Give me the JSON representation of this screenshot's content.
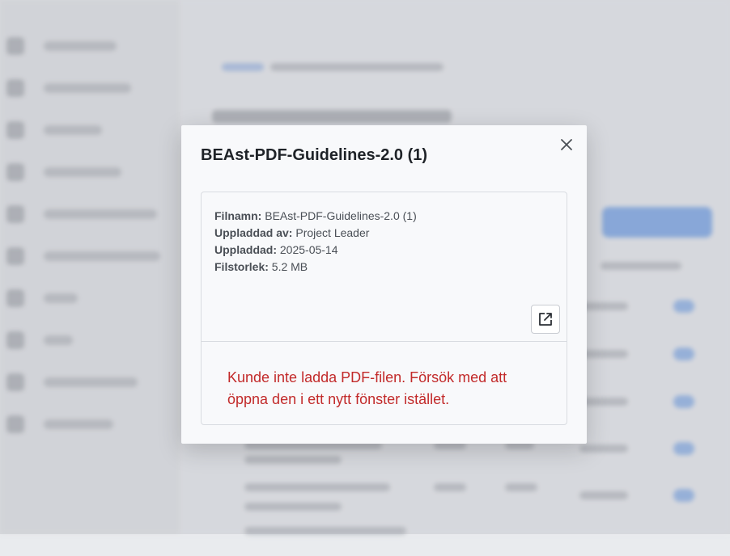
{
  "modal": {
    "title": "BEAst-PDF-Guidelines-2.0 (1)",
    "close_icon": "close-icon",
    "info": {
      "filename_label": "Filnamn:",
      "filename_value": "BEAst-PDF-Guidelines-2.0 (1)",
      "uploaded_by_label": "Uppladdad av:",
      "uploaded_by_value": "Project Leader",
      "uploaded_label": "Uppladdad:",
      "uploaded_value": "2025-05-14",
      "size_label": "Filstorlek:",
      "size_value": "5.2 MB"
    },
    "open_external_icon": "external-link-icon",
    "error_message": "Kunde inte ladda PDF-filen. Försök med att öppna den i ett nytt fönster istället.",
    "colors": {
      "error": "#c22a2a",
      "title": "#1f2328"
    }
  }
}
